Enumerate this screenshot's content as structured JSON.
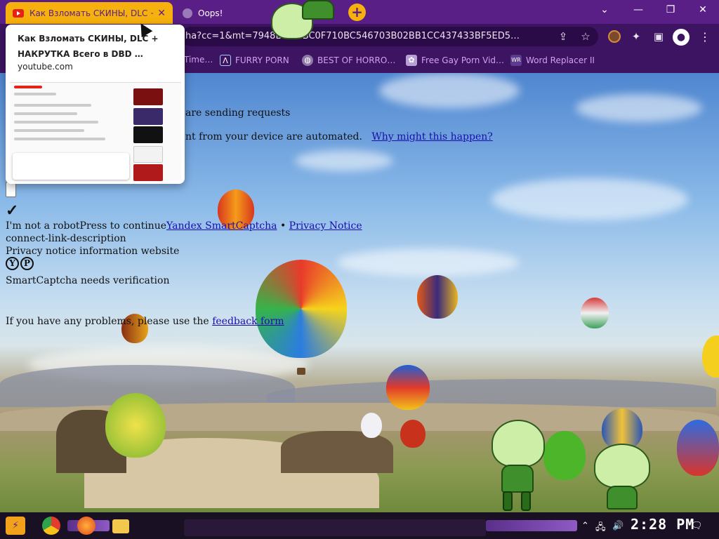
{
  "browser": {
    "tabs": [
      {
        "title": "Как Взломать СКИНЫ, DLC + Н",
        "active": true,
        "favicon": "youtube-icon"
      },
      {
        "title": "Oops!",
        "active": false,
        "favicon": "globe-icon"
      }
    ],
    "new_tab_label": "+",
    "url": "ha?cc=1&mt=7948B…BFBC0F710BC546703B02BB1CC437433BF5ED5…",
    "bookmarks": [
      {
        "label": "Time…",
        "icon": "music-icon"
      },
      {
        "label": "FURRY PORN",
        "icon": "arrow-logo-icon"
      },
      {
        "label": "BEST OF HORRO…",
        "icon": "globe-icon"
      },
      {
        "label": "Free Gay Porn Vid…",
        "icon": "app-icon"
      },
      {
        "label": "Word Replacer II",
        "icon": "wr-icon"
      }
    ],
    "colors": {
      "tab_active": "#f6b10e",
      "chrome": "#3d1461",
      "tab_strip": "#5a1f86",
      "bookmark_text": "#d49ff5"
    }
  },
  "hover_card": {
    "title": "Как Взломать СКИНЫ, DLC + НАКРУТКА Всего в DBD …",
    "domain": "youtube.com"
  },
  "captcha": {
    "line_sending": "are sending requests",
    "line_automated": "nt from your device are automated.",
    "why_link": "Why might this happen?",
    "robot_text": "I'm not a robotPress to continue",
    "smartcaptcha_link": "Yandex SmartCaptcha",
    "bullet": "•",
    "privacy_link": "Privacy Notice",
    "connect_desc": "connect-link-description",
    "privacy_info": "Privacy notice information website",
    "logo_letters": [
      "Y",
      "P"
    ],
    "needs_verification": "SmartCaptcha needs verification",
    "problems_text": "If you have any problems, please use the",
    "feedback_link": "feedback form",
    "checkmark": "✓"
  },
  "taskbar": {
    "clock": "2:28 PM"
  }
}
